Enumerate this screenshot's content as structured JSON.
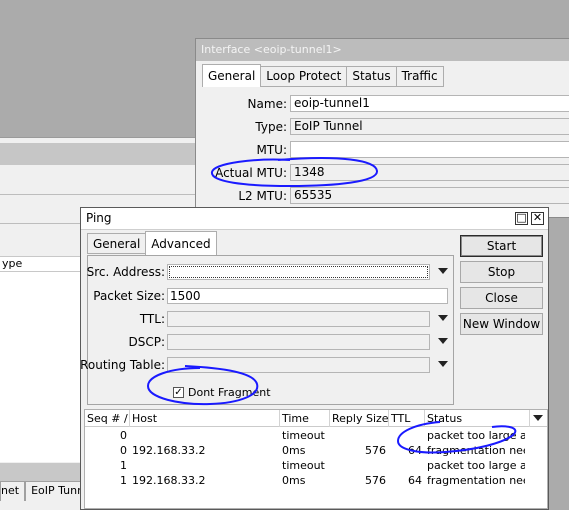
{
  "background_window": {
    "column_header": "ype",
    "tabs": [
      "net",
      "EoIP Tunne"
    ]
  },
  "interface_window": {
    "title": "Interface <eoip-tunnel1>",
    "tabs": [
      "General",
      "Loop Protect",
      "Status",
      "Traffic"
    ],
    "fields": {
      "name_label": "Name:",
      "name_value": "eoip-tunnel1",
      "type_label": "Type:",
      "type_value": "EoIP Tunnel",
      "mtu_label": "MTU:",
      "mtu_value": "",
      "actual_mtu_label": "Actual MTU:",
      "actual_mtu_value": "1348",
      "l2mtu_label": "L2 MTU:",
      "l2mtu_value": "65535"
    }
  },
  "ping_window": {
    "title": "Ping",
    "maximize_glyph": "□",
    "close_glyph": "✕",
    "tabs": [
      "General",
      "Advanced"
    ],
    "fields": {
      "src_address_label": "Src. Address:",
      "src_address_value": "",
      "packet_size_label": "Packet Size:",
      "packet_size_value": "1500",
      "ttl_label": "TTL:",
      "ttl_value": "",
      "dscp_label": "DSCP:",
      "dscp_value": "",
      "routing_table_label": "Routing Table:",
      "routing_table_value": "",
      "dont_fragment_label": "Dont Fragment",
      "dont_fragment_checked": "✓"
    },
    "buttons": {
      "start": "Start",
      "stop": "Stop",
      "close": "Close",
      "new_window": "New Window"
    },
    "table": {
      "columns": [
        "Seq # /",
        "Host",
        "Time",
        "Reply Size",
        "TTL",
        "Status"
      ],
      "rows": [
        {
          "seq": "0",
          "host": "",
          "time": "timeout",
          "reply_size": "",
          "ttl": "",
          "status": "packet too large a..."
        },
        {
          "seq": "0",
          "host": "192.168.33.2",
          "time": "0ms",
          "reply_size": "576",
          "ttl": "64",
          "status": "fragmentation nee..."
        },
        {
          "seq": "1",
          "host": "",
          "time": "timeout",
          "reply_size": "",
          "ttl": "",
          "status": "packet too large a..."
        },
        {
          "seq": "1",
          "host": "192.168.33.2",
          "time": "0ms",
          "reply_size": "576",
          "ttl": "64",
          "status": "fragmentation nee..."
        }
      ]
    }
  },
  "colors": {
    "annotation": "#1a1aff",
    "desktop": "#ababab"
  }
}
